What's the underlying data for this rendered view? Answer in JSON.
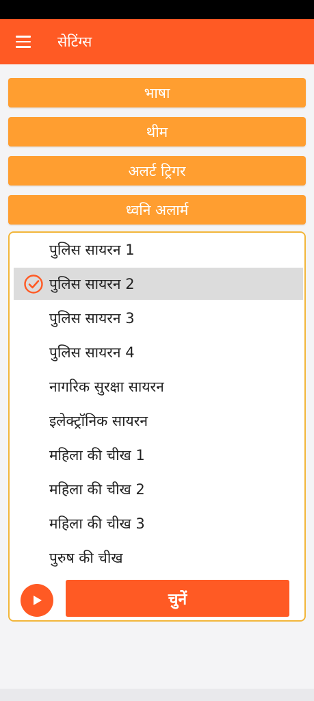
{
  "app_bar": {
    "title": "सेटिंग्स"
  },
  "settings_buttons": [
    "भाषा",
    "थीम",
    "अलर्ट ट्रिगर",
    "ध्वनि अलार्म"
  ],
  "sounds": [
    "पुलिस सायरन 1",
    "पुलिस सायरन 2",
    "पुलिस सायरन 3",
    "पुलिस सायरन 4",
    "नागरिक सुरक्षा सायरन",
    "इलेक्ट्रॉनिक सायरन",
    "महिला की चीख 1",
    "महिला की चीख 2",
    "महिला की चीख 3",
    "पुरुष की चीख"
  ],
  "selected_sound_index": 1,
  "choose_label": "चुनें",
  "colors": {
    "primary": "#ff5a24",
    "button": "#ff9e30",
    "panel_border": "#f2b63a",
    "selected_bg": "#dcdcdc"
  }
}
